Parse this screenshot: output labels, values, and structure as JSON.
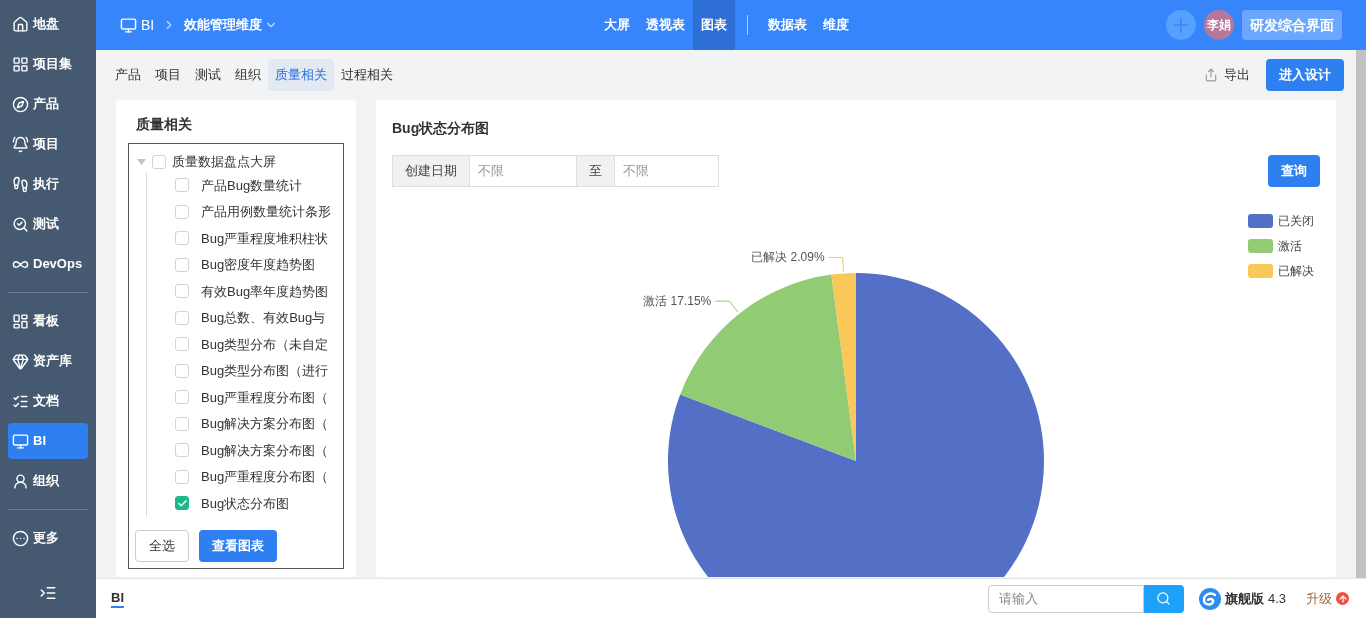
{
  "sidebar": {
    "items": [
      {
        "label": "地盘",
        "selected": false
      },
      {
        "label": "项目集",
        "selected": false
      },
      {
        "label": "产品",
        "selected": false
      },
      {
        "label": "项目",
        "selected": false
      },
      {
        "label": "执行",
        "selected": false
      },
      {
        "label": "测试",
        "selected": false
      },
      {
        "label": "DevOps",
        "selected": false
      },
      {
        "kind": "divider"
      },
      {
        "label": "看板",
        "selected": false
      },
      {
        "label": "资产库",
        "selected": false
      },
      {
        "label": "文档",
        "selected": false
      },
      {
        "label": "BI",
        "selected": true
      },
      {
        "label": "组织",
        "selected": false
      },
      {
        "kind": "divider"
      },
      {
        "label": "更多",
        "selected": false
      }
    ]
  },
  "topbar": {
    "module": "BI",
    "dimension": "效能管理维度",
    "tabs": [
      {
        "label": "大屏",
        "selected": false
      },
      {
        "label": "透视表",
        "selected": false
      },
      {
        "label": "图表",
        "selected": true
      },
      {
        "kind": "divider"
      },
      {
        "label": "数据表",
        "selected": false
      },
      {
        "label": "维度",
        "selected": false
      }
    ],
    "avatar": "李娟",
    "workspace": "研发综合界面"
  },
  "subtabs": [
    {
      "label": "产品",
      "selected": false
    },
    {
      "label": "项目",
      "selected": false
    },
    {
      "label": "测试",
      "selected": false
    },
    {
      "label": "组织",
      "selected": false
    },
    {
      "label": "质量相关",
      "selected": true
    },
    {
      "label": "过程相关",
      "selected": false
    }
  ],
  "export": "导出",
  "design_button": "进入设计",
  "left_panel": {
    "title": "质量相关",
    "tree": [
      {
        "label": "质量数据盘点大屏",
        "checked": false,
        "expanded": true,
        "children": [
          {
            "label": "产品Bug数量统计",
            "checked": false
          },
          {
            "label": "产品用例数量统计条形",
            "checked": false
          },
          {
            "label": "Bug严重程度堆积柱状",
            "checked": false
          },
          {
            "label": "Bug密度年度趋势图",
            "checked": false
          },
          {
            "label": "有效Bug率年度趋势图",
            "checked": false
          },
          {
            "label": "Bug总数、有效Bug与",
            "checked": false
          },
          {
            "label": "Bug类型分布（未自定",
            "checked": false
          },
          {
            "label": "Bug类型分布图（进行",
            "checked": false
          },
          {
            "label": "Bug严重程度分布图（",
            "checked": false
          },
          {
            "label": "Bug解决方案分布图（",
            "checked": false
          },
          {
            "label": "Bug解决方案分布图（",
            "checked": false
          },
          {
            "label": "Bug严重程度分布图（",
            "checked": false
          },
          {
            "label": "Bug状态分布图",
            "checked": true
          }
        ]
      }
    ],
    "select_all": "全选",
    "view_button": "查看图表"
  },
  "chart_panel": {
    "title": "Bug状态分布图",
    "filter": {
      "label": "创建日期",
      "from_placeholder": "不限",
      "separator": "至",
      "to_placeholder": "不限",
      "query": "查询"
    },
    "legend": [
      {
        "color": "#5470c6"
      },
      {
        "color": "#91cc75"
      },
      {
        "color": "#fac858"
      }
    ],
    "chart_data": {
      "type": "pie",
      "categories": [
        "已关闭",
        "激活",
        "已解决"
      ],
      "values": [
        80.76,
        17.15,
        2.09
      ],
      "annotations": [
        null,
        "激活 17.15%",
        "已解决 2.09%"
      ]
    }
  },
  "bottombar": {
    "tab": "BI",
    "search_placeholder": "请输入",
    "edition": "旗舰版",
    "version": "4.3",
    "upgrade": "升级"
  }
}
